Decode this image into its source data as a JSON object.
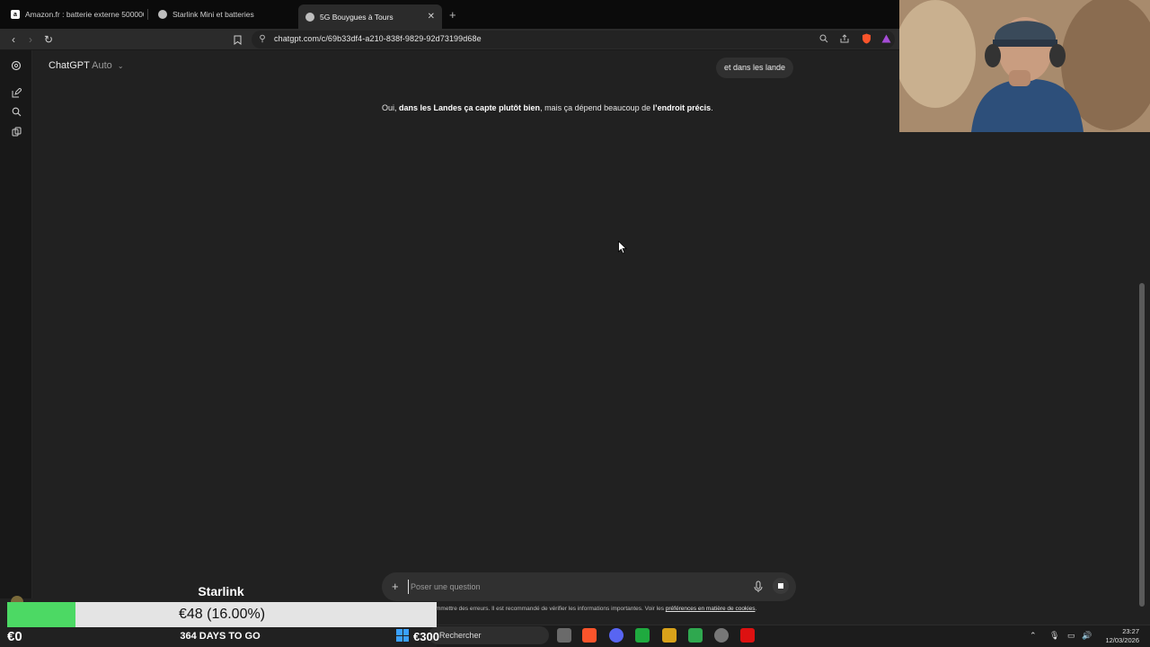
{
  "browser": {
    "tabs": [
      {
        "title": "Amazon.fr : batterie externe 500000",
        "icon": "amazon-icon"
      },
      {
        "title": "Starlink Mini et batteries",
        "icon": "chatgpt-icon"
      },
      {
        "title": "5G Bouygues à Tours",
        "icon": "chatgpt-icon",
        "active": true
      }
    ],
    "url": "chatgpt.com/c/69b33df4-a210-838f-9829-92d73199d68e"
  },
  "chatgpt": {
    "model_name": "ChatGPT",
    "model_mode": "Auto",
    "user_message": "et dans les lande",
    "assistant_message": {
      "part1": "Oui, ",
      "bold1": "dans les Landes ça capte plutôt bien",
      "part2": ", mais ça dépend beaucoup de ",
      "bold2": "l’endroit précis",
      "part3": "."
    },
    "composer_placeholder": "Poser une question",
    "disclaimer": "mmettre des erreurs. Il est recommandé de vérifier les informations importantes. Voir les ",
    "disclaimer_link": "préférences en matière de cookies",
    "disclaimer_end": "."
  },
  "overlay": {
    "title": "Starlink",
    "amount": "€48 (16.00%)",
    "progress_fraction": 0.16,
    "start": "€0",
    "days_left": "364 DAYS TO GO",
    "goal": "€300",
    "fill_color": "#4cd964"
  },
  "taskbar": {
    "search_label": "Rechercher",
    "time": "23:27",
    "date": "12/03/2026"
  }
}
